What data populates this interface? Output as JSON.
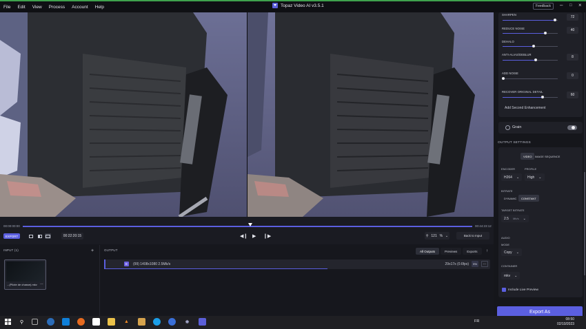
{
  "app": {
    "title": "Topaz Video AI  v3.5.1",
    "feedback_label": "Feedback"
  },
  "menu": [
    "File",
    "Edit",
    "View",
    "Process",
    "Account",
    "Help"
  ],
  "timeline": {
    "start_time": "00:00:00:00",
    "end_time": "00:44:23:12",
    "current_time": "00:22:20:15",
    "export_label": "EXPORT",
    "zoom": "121",
    "zoom_unit": "%",
    "back_to_input": "Back to Input"
  },
  "input_panel": {
    "title": "INPUT (1)",
    "file_name": "...(Pilote de chasse).mkv"
  },
  "output_panel": {
    "title": "OUTPUT",
    "tabs": [
      "All Outputs",
      "Previews",
      "Exports"
    ],
    "row": {
      "badge": "E",
      "text": "(99)  1408x1080  2.5Mb/s",
      "right": "29x17s (0.6fps)",
      "percent": "9%"
    }
  },
  "enhancement": {
    "sliders": [
      {
        "label": "SHARPEN",
        "value": "72",
        "level": 0.96
      },
      {
        "label": "REDUCE NOISE",
        "value": "40",
        "level": 0.78
      },
      {
        "label": "DEHALO",
        "value": "",
        "level": 0.56
      },
      {
        "label": "ANTI-ALIAS/DEBLUR",
        "value": "8",
        "level": 0.6
      },
      {
        "label": "ADD NOISE",
        "value": "0",
        "level": 0.0
      },
      {
        "label": "RECOVER ORIGINAL DETAIL",
        "value": "60",
        "level": 0.72
      }
    ],
    "add_second": "Add Second Enhancement",
    "grain_label": "Grain"
  },
  "output_settings": {
    "title": "OUTPUT SETTINGS",
    "seg_video": "VIDEO",
    "seg_image": "IMAGE SEQUENCE",
    "encoder_label": "ENCODER",
    "encoder_value": "H264",
    "profile_label": "PROFILE",
    "profile_value": "High",
    "bitrate_label": "BITRATE",
    "bitrate_dynamic": "DYNAMIC",
    "bitrate_constant": "CONSTANT",
    "target_label": "TARGET BITRATE",
    "target_value": "2.5",
    "target_unit": "Mb/s",
    "audio_label": "AUDIO",
    "mode_label": "MODE",
    "mode_value": "Copy",
    "container_label": "CONTAINER",
    "container_value": "mkv",
    "live_preview": "Include Live Preview",
    "export_as": "Export As"
  },
  "taskbar": {
    "lang": "FR",
    "time": "08:50",
    "date": "02/10/2023"
  },
  "colors": {
    "accent": "#5b5fe0",
    "window_accent": "#3fa34d"
  }
}
